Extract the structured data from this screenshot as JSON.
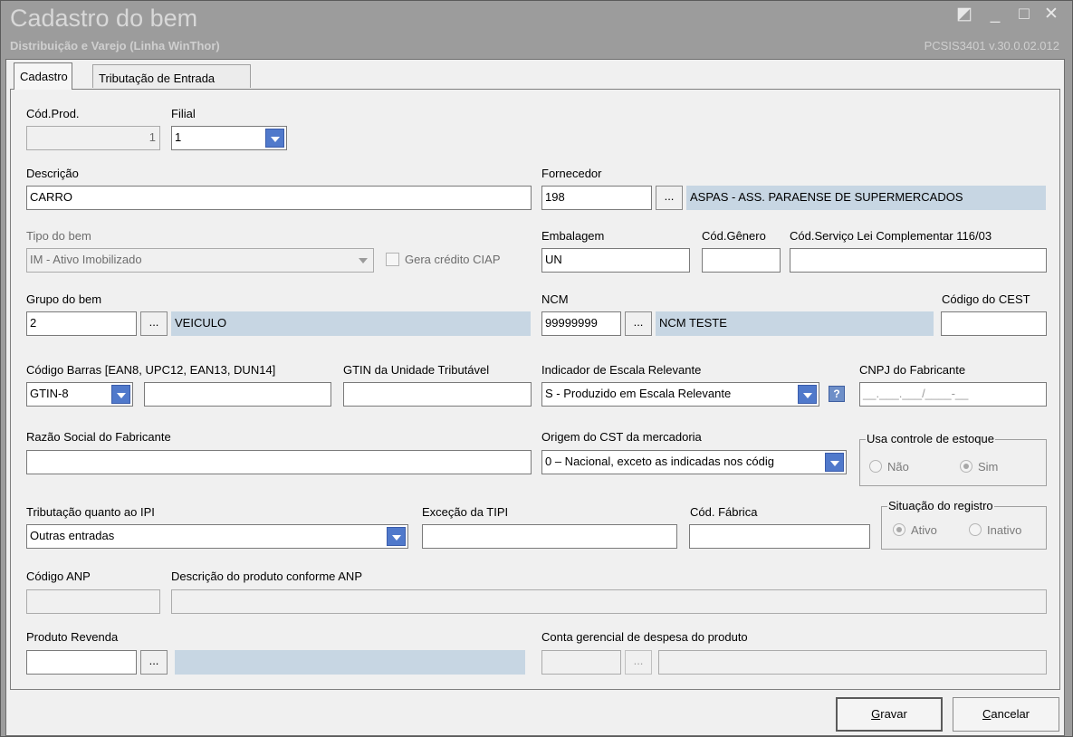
{
  "window": {
    "title": "Cadastro do bem",
    "subtitle": "Distribuição e Varejo (Linha WinThor)",
    "version": "PCSIS3401  v.30.0.02.012"
  },
  "tabs": [
    {
      "label": "Cadastro",
      "active": true
    },
    {
      "label": "Tributação de Entrada",
      "active": false
    }
  ],
  "form": {
    "cod_prod": {
      "label": "Cód.Prod.",
      "value": "1"
    },
    "filial": {
      "label": "Filial",
      "value": "1"
    },
    "descricao": {
      "label": "Descrição",
      "value": "CARRO"
    },
    "fornecedor": {
      "label": "Fornecedor",
      "code": "198",
      "name": "ASPAS - ASS. PARAENSE DE SUPERMERCADOS"
    },
    "tipo_bem": {
      "label": "Tipo do bem",
      "value": "IM - Ativo Imobilizado"
    },
    "gera_credito": {
      "label": "Gera crédito CIAP"
    },
    "embalagem": {
      "label": "Embalagem",
      "value": "UN"
    },
    "cod_genero": {
      "label": "Cód.Gênero",
      "value": ""
    },
    "cod_servico": {
      "label": "Cód.Serviço Lei Complementar 116/03",
      "value": ""
    },
    "grupo_bem": {
      "label": "Grupo do bem",
      "code": "2",
      "name": "VEICULO"
    },
    "ncm": {
      "label": "NCM",
      "code": "99999999",
      "name": "NCM TESTE"
    },
    "codigo_cest": {
      "label": "Código do CEST",
      "value": ""
    },
    "codigo_barras": {
      "label": "Código Barras [EAN8, UPC12, EAN13, DUN14]",
      "type": "GTIN-8",
      "value": ""
    },
    "gtin": {
      "label": "GTIN da Unidade Tributável",
      "value": ""
    },
    "indicador_escala": {
      "label": "Indicador de Escala Relevante",
      "value": "S - Produzido em Escala Relevante",
      "help": "?"
    },
    "cnpj_fabricante": {
      "label": "CNPJ do Fabricante",
      "placeholder": "__.___.___/____-__"
    },
    "razao_social": {
      "label": "Razão Social do Fabricante",
      "value": ""
    },
    "origem_cst": {
      "label": "Origem do CST da mercadoria",
      "value": "0 – Nacional, exceto as indicadas nos códig"
    },
    "controle_estoque": {
      "title": "Usa controle de estoque",
      "options": [
        "Não",
        "Sim"
      ],
      "selected": "Sim"
    },
    "tributacao_ipi": {
      "label": "Tributação quanto ao IPI",
      "value": "Outras entradas"
    },
    "excecao_tipi": {
      "label": "Exceção da TIPI",
      "value": ""
    },
    "cod_fabrica": {
      "label": "Cód. Fábrica",
      "value": ""
    },
    "situacao_registro": {
      "title": "Situação do registro",
      "options": [
        "Ativo",
        "Inativo"
      ],
      "selected": "Ativo"
    },
    "codigo_anp": {
      "label": "Código ANP",
      "value": ""
    },
    "descricao_anp": {
      "label": "Descrição do produto conforme ANP",
      "value": ""
    },
    "produto_revenda": {
      "label": "Produto Revenda",
      "code": "",
      "name": ""
    },
    "conta_gerencial": {
      "label": "Conta gerencial de despesa do produto",
      "code": "",
      "name": ""
    }
  },
  "buttons": {
    "gravar": {
      "label_first": "G",
      "label_rest": "ravar"
    },
    "cancelar": {
      "label_first": "C",
      "label_rest": "ancelar"
    },
    "ellipsis": "..."
  },
  "colors": {
    "title_bar": "#9c9c9c",
    "readonly_fill": "#c7d6e3",
    "dropdown_button": "#5079cb"
  }
}
